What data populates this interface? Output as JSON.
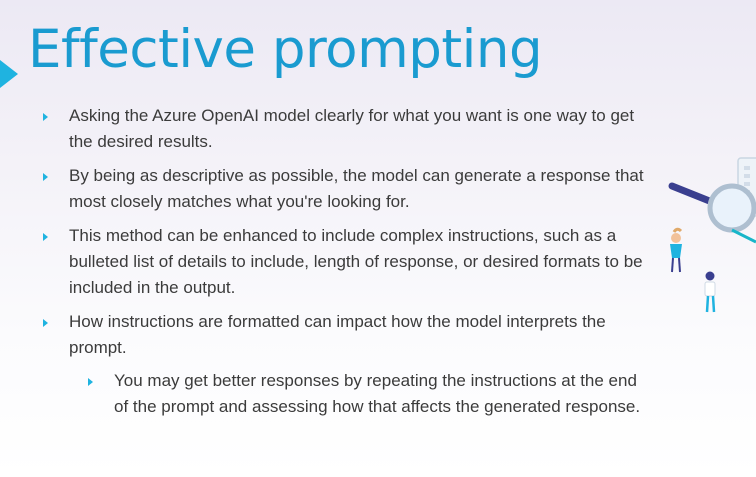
{
  "title": "Effective prompting",
  "colors": {
    "accent": "#1fb3e0",
    "title": "#1a9bd0",
    "text": "#3b3b3b"
  },
  "bullets": [
    {
      "text": "Asking the Azure OpenAI model clearly for what you want is one way to get the desired results."
    },
    {
      "text": "By being as descriptive as possible, the model can generate a response that most closely matches what you're looking for."
    },
    {
      "text": "This method can be enhanced to include complex instructions, such as a bulleted list of details to include, length of response, or desired formats to be included in the output."
    },
    {
      "text": "How instructions are formatted can impact how the model interprets the prompt.",
      "sub": [
        {
          "text": "You may get better responses by repeating the instructions at the end of the prompt and assessing how that affects the generated response."
        }
      ]
    }
  ],
  "illustration": {
    "icon": "magnifier-people-illustration"
  }
}
